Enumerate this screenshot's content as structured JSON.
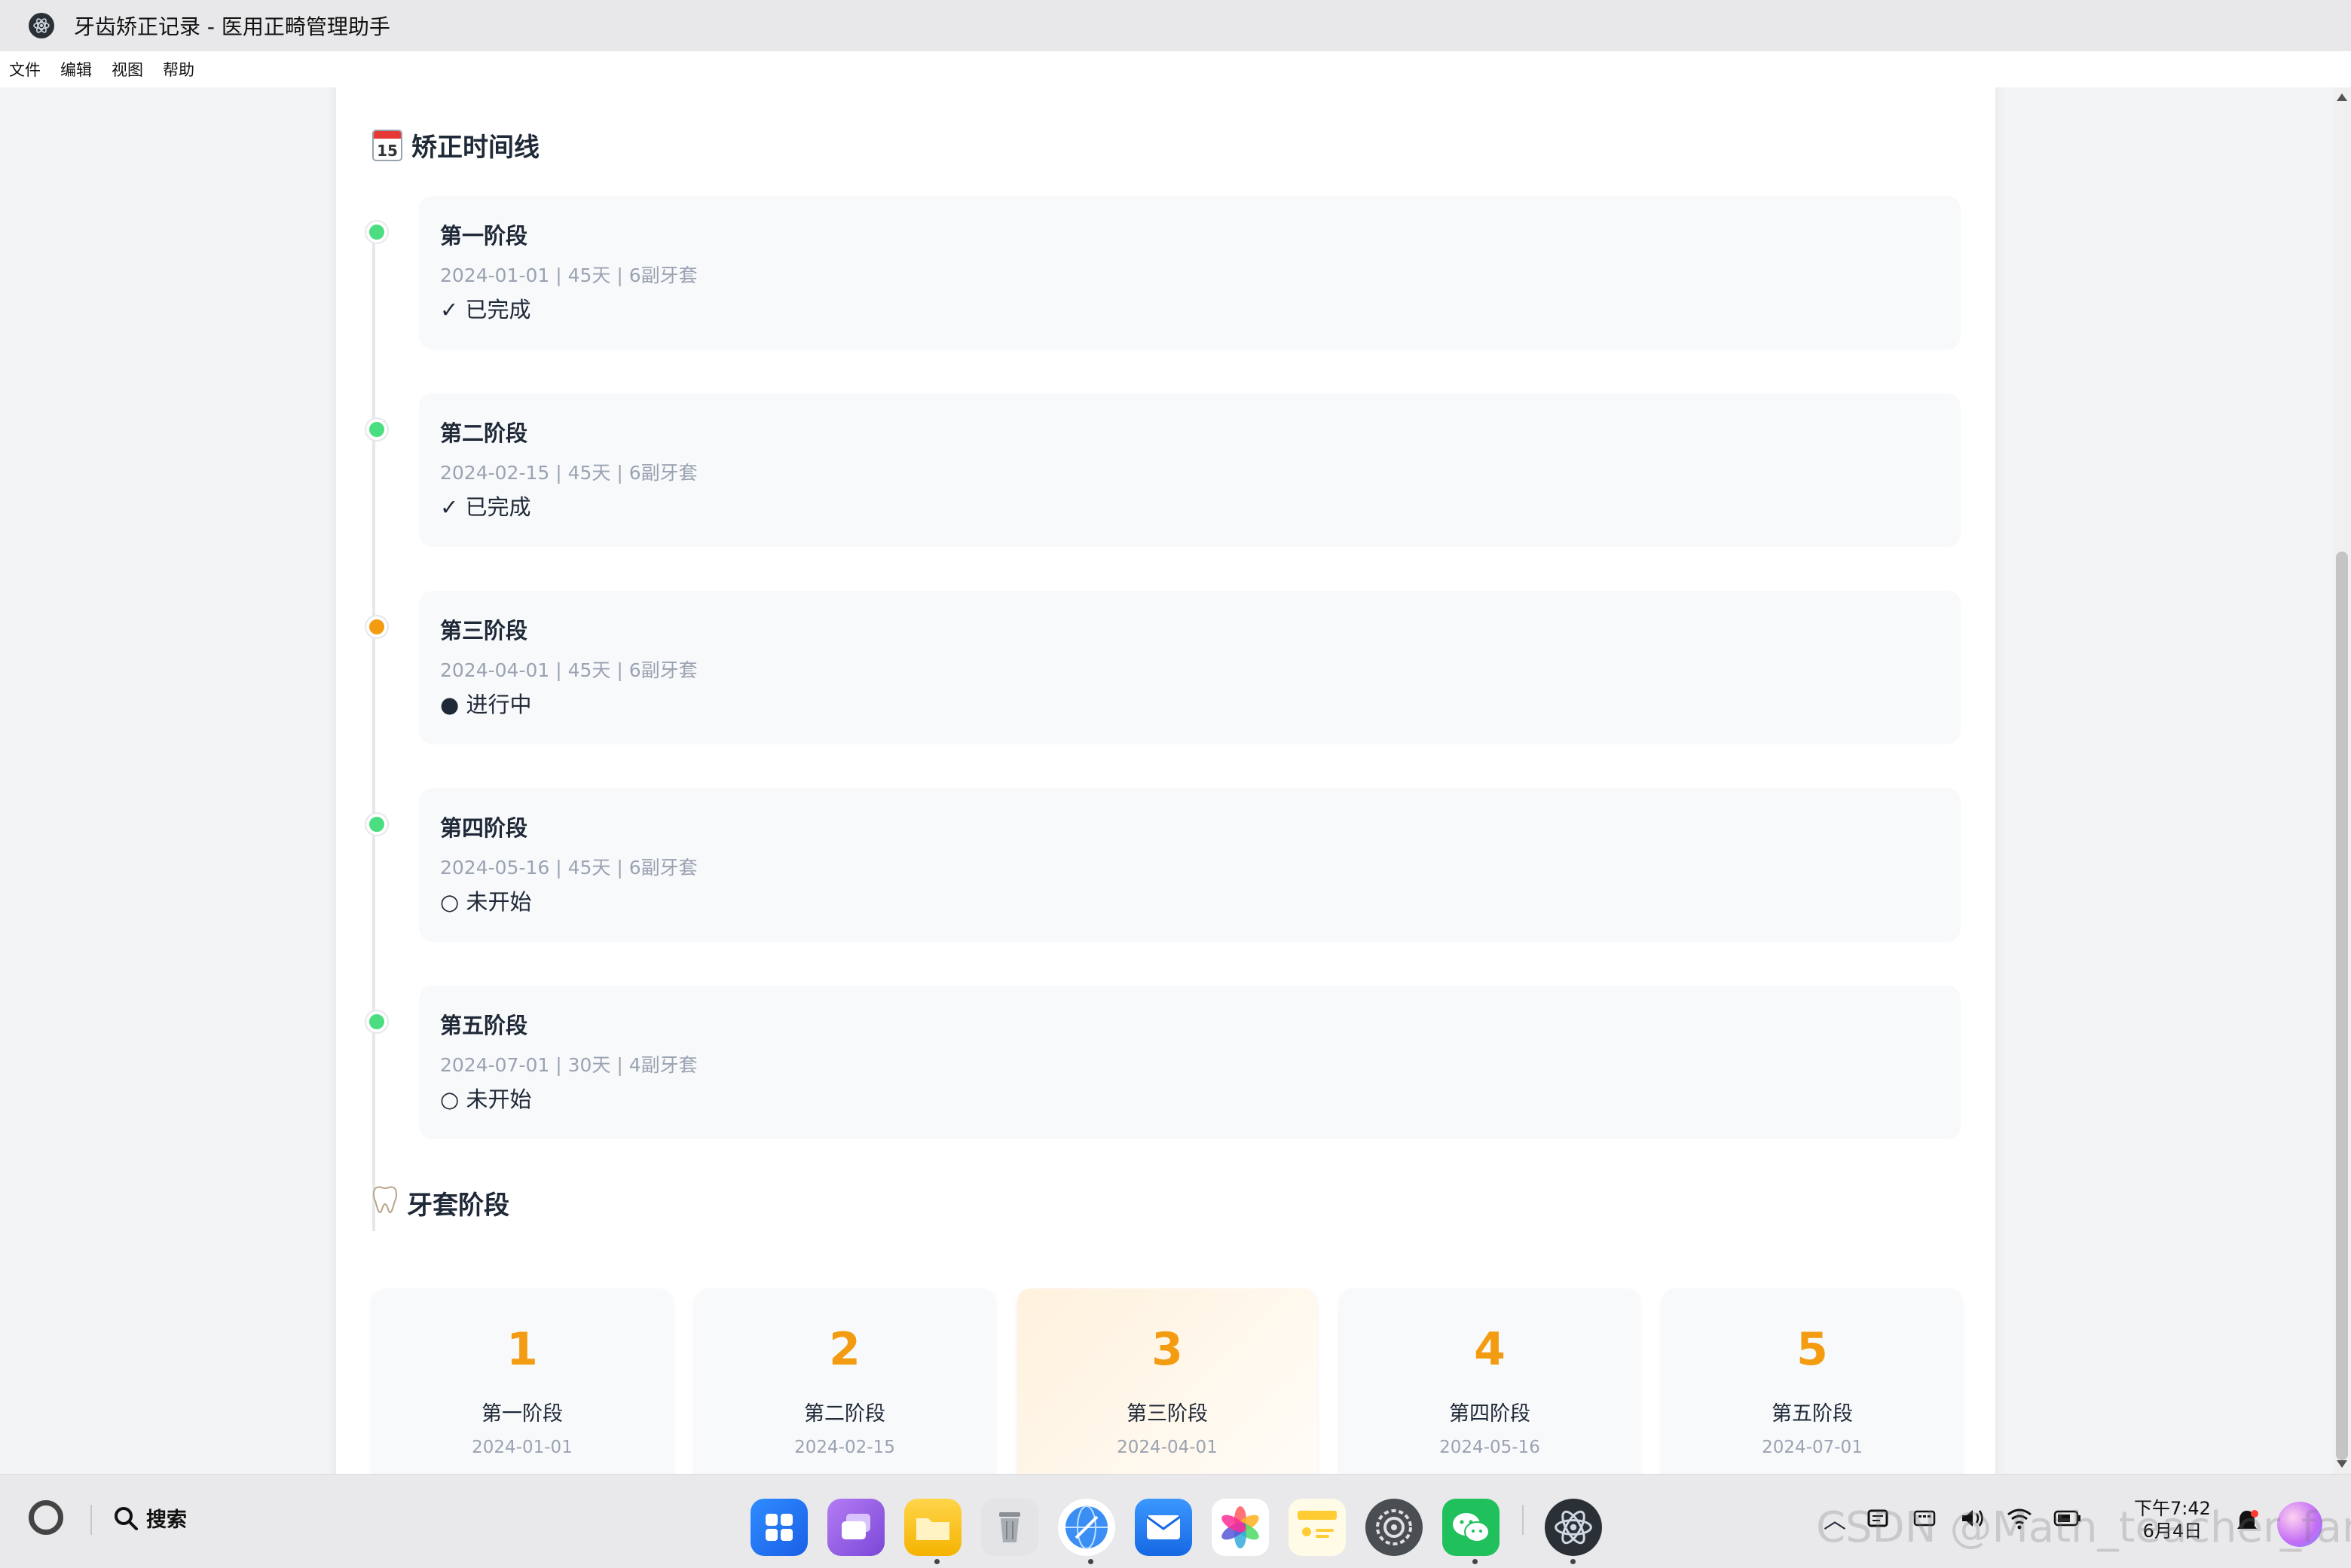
{
  "window": {
    "title": "牙齿矫正记录 - 医用正畸管理助手"
  },
  "menu": [
    "文件",
    "编辑",
    "视图",
    "帮助"
  ],
  "timeline": {
    "title": "矫正时间线",
    "icon": "calendar-icon",
    "calendar_day": "15",
    "stages": [
      {
        "name": "第一阶段",
        "meta": "2024-01-01 | 45天 | 6副牙套",
        "status": "✓ 已完成",
        "dot_color": "#4ade80"
      },
      {
        "name": "第二阶段",
        "meta": "2024-02-15 | 45天 | 6副牙套",
        "status": "✓ 已完成",
        "dot_color": "#4ade80"
      },
      {
        "name": "第三阶段",
        "meta": "2024-04-01 | 45天 | 6副牙套",
        "status": "● 进行中",
        "dot_color": "#f39c12"
      },
      {
        "name": "第四阶段",
        "meta": "2024-05-16 | 45天 | 6副牙套",
        "status": "○ 未开始",
        "dot_color": "#4ade80"
      },
      {
        "name": "第五阶段",
        "meta": "2024-07-01 | 30天 | 4副牙套",
        "status": "○ 未开始",
        "dot_color": "#4ade80"
      }
    ]
  },
  "phases": {
    "title": "牙套阶段",
    "icon": "tooth-icon",
    "items": [
      {
        "num": "1",
        "name": "第一阶段",
        "date": "2024-01-01",
        "bar_color": "#4ade80",
        "active": false
      },
      {
        "num": "2",
        "name": "第二阶段",
        "date": "2024-02-15",
        "bar_color": "#4ade80",
        "active": false
      },
      {
        "num": "3",
        "name": "第三阶段",
        "date": "2024-04-01",
        "bar_color": "#f39c12",
        "active": true
      },
      {
        "num": "4",
        "name": "第四阶段",
        "date": "2024-05-16",
        "bar_color": "#e5e7eb",
        "active": false
      },
      {
        "num": "5",
        "name": "第五阶段",
        "date": "2024-07-01",
        "bar_color": "#e5e7eb",
        "active": false
      }
    ]
  },
  "taskbar": {
    "search_label": "搜索",
    "time": "下午7:42",
    "date": "6月4日",
    "watermark": "CSDN @Math_teacher_fan",
    "apps": [
      "launcher-icon",
      "multitask-icon",
      "files-icon",
      "trash-icon",
      "browser-icon",
      "mail-icon",
      "photos-icon",
      "notes-icon",
      "settings-icon",
      "wechat-icon",
      "electron-app-icon"
    ]
  },
  "colors": {
    "accent_orange": "#f39c12",
    "done_green": "#4ade80",
    "meta_gray": "#9aa3b2"
  }
}
